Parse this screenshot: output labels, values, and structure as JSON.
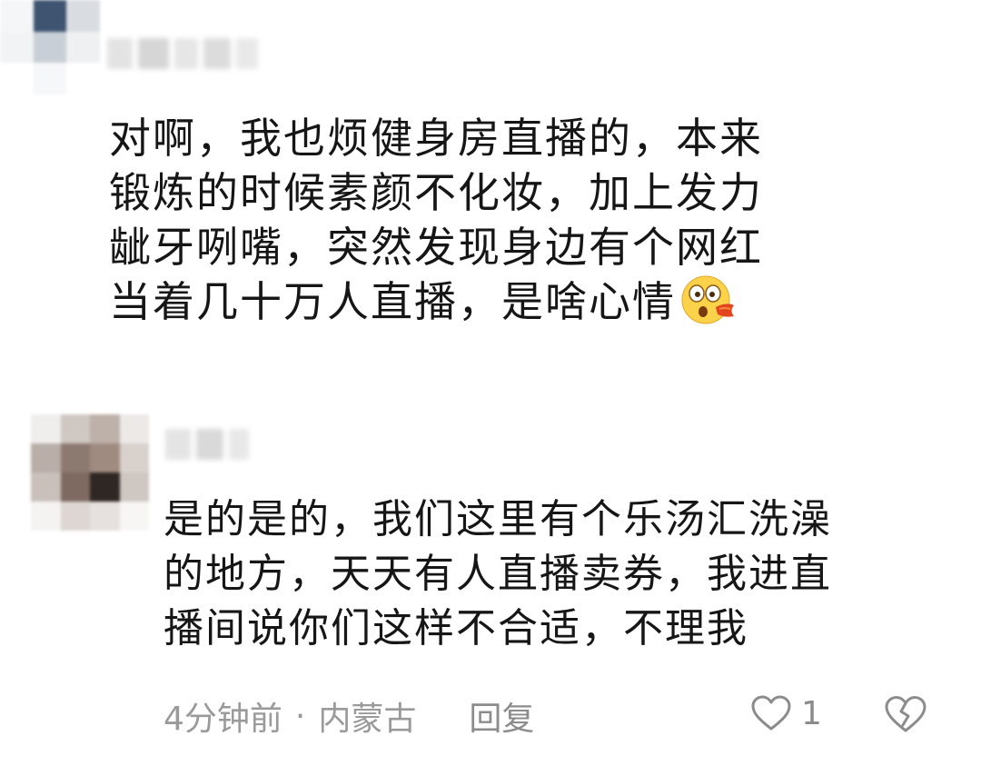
{
  "comments": [
    {
      "author_blurred": true,
      "text": "对啊，我也烦健身房直播的，本来\n锻炼的时候素颜不化妆，加上发力\n龇牙咧嘴，突然发现身边有个网红\n当着几十万人直播，是啥心情",
      "emoji": "shocked-face-emoji"
    },
    {
      "author_blurred": true,
      "text": "是的是的，我们这里有个乐汤汇洗澡\n的地方，天天有人直播卖券，我进直\n播间说你们这样不合适，不理我",
      "time": "4分钟前",
      "separator": "·",
      "location": "内蒙古",
      "reply_label": "回复",
      "like_count": "1",
      "icons": {
        "like": "heart-outline-icon",
        "dislike": "broken-heart-icon"
      }
    }
  ],
  "colors": {
    "meta_text": "#9a9a9a",
    "body_text": "#161616",
    "icon": "#8c8c8c"
  }
}
